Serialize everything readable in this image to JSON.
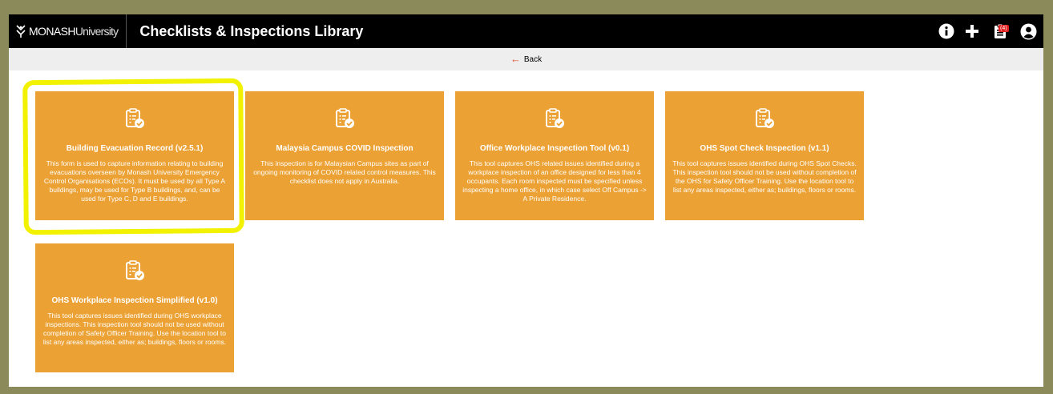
{
  "header": {
    "logo_strong": "MONASH",
    "logo_light": "University",
    "title": "Checklists & Inspections Library",
    "badge_count": "(4)"
  },
  "nav": {
    "back_label": "Back"
  },
  "cards": [
    {
      "title": "Building Evacuation Record (v2.5.1)",
      "description": "This form is used to capture information relating to building evacuations overseen by Monash University Emergency Control Organisations (ECOs). It must be used by all Type A buildings, may be used for Type B buildings, and, can be used for Type C, D and E buildings."
    },
    {
      "title": "Malaysia Campus COVID Inspection",
      "description": "This inspection is for Malaysian Campus sites as part of ongoing monitoring of COVID related control measures. This checklist does not apply in Australia."
    },
    {
      "title": "Office Workplace Inspection Tool (v0.1)",
      "description": "This tool captures OHS related issues identified during a workplace inspection of an office designed for less than 4 occupants. Each room inspected must be specified unless inspecting a home office, in which case select Off Campus -> A Private Residence."
    },
    {
      "title": "OHS Spot Check Inspection (v1.1)",
      "description": "This tool captures issues identified during OHS Spot Checks. This inspection tool should not be used without completion of the OHS for Safety Officer Training. Use the location tool to list any areas inspected, either as; buildings, floors or rooms."
    },
    {
      "title": "OHS Workplace Inspection Simplified (v1.0)",
      "description": "This tool captures issues identified during OHS workplace inspections. This inspection tool should not be used without completion of Safety Officer Training. Use the location tool to list any areas inspected, either as; buildings, floors or rooms."
    }
  ],
  "colors": {
    "card_bg": "#eba133",
    "topbar_bg": "#000000",
    "highlight": "#f2f200",
    "back_arrow": "#e0532a"
  },
  "icons": {
    "card": "clipboard-check-icon",
    "info": "info-icon",
    "add": "plus-icon",
    "checklist": "clipboard-list-icon",
    "user": "user-circle-icon"
  }
}
